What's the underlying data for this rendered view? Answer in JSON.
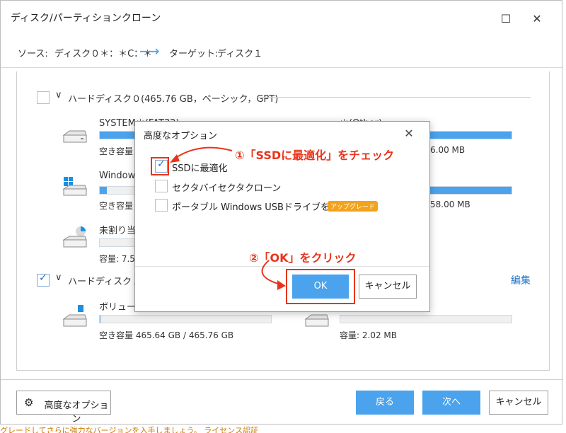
{
  "window": {
    "title": "ディスク/パーティションクローン",
    "maximize_glyph": "☐",
    "close_glyph": "✕"
  },
  "source_bar": {
    "source_label": "ソース:",
    "source_value": "ディスク０＊：＊C：＊",
    "arrow": "⟶",
    "target_label": "ターゲット:",
    "target_value": "ディスク１"
  },
  "disk0": {
    "header": "ハードディスク０(465.76 GB，ベーシック，GPT)",
    "partitions": [
      {
        "name": "SYSTEM＊(FAT32)",
        "detail": "空き容量",
        "icon": "hdd-icon",
        "fill": 0.98
      },
      {
        "name": "Windows",
        "detail": "空き容量",
        "icon": "windows-drive-icon",
        "fill": 0.04
      },
      {
        "name": "未割り当",
        "detail": "容量: 7.5",
        "icon": "unallocated-disk-icon",
        "fill": 0.0
      }
    ],
    "right_partitions": [
      {
        "name": "＊(Other)",
        "detail": "6.00 MB",
        "fill": 1.0
      },
      {
        "name": "",
        "detail": "58.00 MB",
        "fill": 1.0
      }
    ]
  },
  "disk1": {
    "header": "ハードディスク１(",
    "edit_link": "編集",
    "partitions": [
      {
        "name": "ボリューム",
        "detail": "空き容量 465.64 GB / 465.76 GB",
        "fill": 0.005
      },
      {
        "name": "",
        "detail": "容量: 2.02 MB",
        "fill": 0.0
      }
    ]
  },
  "bottom": {
    "advanced_label": "高度なオプション",
    "back_label": "戻る",
    "next_label": "次へ",
    "cancel_label": "キャンセル"
  },
  "footer_text": "グレードしてさらに強力なバージョンを入手しましょう。 ライセンス認証",
  "dialog": {
    "title": "高度なオプション",
    "options": [
      {
        "label": "SSDに最適化",
        "checked": true
      },
      {
        "label": "セクタバイセクタクローン",
        "checked": false
      },
      {
        "label": "ポータブル Windows USBドライブを作成",
        "checked": false,
        "badge": "アップグレード"
      }
    ],
    "ok_label": "OK",
    "cancel_label": "キャンセル"
  },
  "annotations": {
    "step1": "①「SSDに最適化」をチェック",
    "step2": "②「OK」をクリック"
  },
  "colors": {
    "accent": "#4aa3ec",
    "annotation": "#e8341c",
    "link": "#1e73c8",
    "badge": "#f2a31b"
  }
}
